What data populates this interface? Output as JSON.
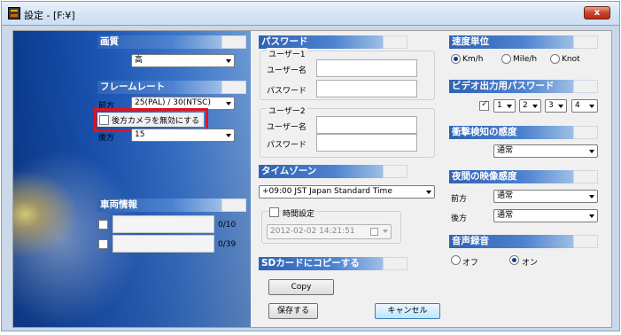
{
  "window": {
    "title": "設定 - [F:¥]",
    "close_label": "x"
  },
  "image_quality": {
    "header": "画質",
    "value": "高"
  },
  "frame_rate": {
    "header": "フレームレート",
    "front_label": "前方",
    "front_value": "25(PAL) / 30(NTSC)",
    "disable_rear_label": "後方カメラを無効にする",
    "rear_label": "後方",
    "rear_value": "15"
  },
  "vehicle_info": {
    "header": "車両情報",
    "row1_counter": "0/10",
    "row2_counter": "0/39"
  },
  "password": {
    "header": "パスワード",
    "user1": {
      "title": "ユーザー1",
      "username_label": "ユーザー名",
      "password_label": "パスワード"
    },
    "user2": {
      "title": "ユーザー2",
      "username_label": "ユーザー名",
      "password_label": "パスワード"
    }
  },
  "timezone": {
    "header": "タイムゾーン",
    "value": "+09:00 JST Japan Standard Time",
    "time_setting_label": "時間設定",
    "datetime_value": "2012-02-02 14:21:51"
  },
  "sd_copy": {
    "header": "SDカードにコピーする",
    "copy_label": "Copy"
  },
  "buttons": {
    "save_label": "保存する",
    "cancel_label": "キャンセル"
  },
  "speed_unit": {
    "header": "速度単位",
    "options": [
      "Km/h",
      "Mile/h",
      "Knot"
    ],
    "selected": "Km/h"
  },
  "video_password": {
    "header": "ビデオ出力用パスワード",
    "digits": [
      "1",
      "2",
      "3",
      "4"
    ]
  },
  "impact_sensitivity": {
    "header": "衝撃検知の感度",
    "value": "通常"
  },
  "night_sensitivity": {
    "header": "夜間の映像感度",
    "front_label": "前方",
    "front_value": "通常",
    "rear_label": "後方",
    "rear_value": "通常"
  },
  "audio_recording": {
    "header": "音声録音",
    "off_label": "オフ",
    "on_label": "オン",
    "selected": "オン"
  },
  "colors": {
    "accent": "#2f62b5",
    "highlight": "#e0141e"
  }
}
